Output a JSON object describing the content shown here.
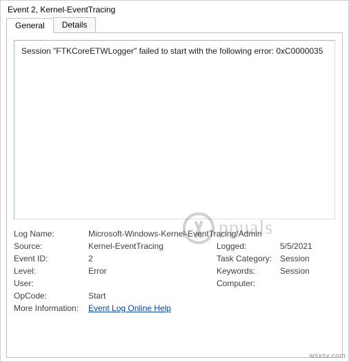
{
  "window": {
    "title": "Event 2, Kernel-EventTracing"
  },
  "tabs": {
    "general": "General",
    "details": "Details",
    "active": "general"
  },
  "description": "Session \"FTKCoreETWLogger\" failed to start with the following error: 0xC0000035",
  "meta": {
    "log_name_label": "Log Name:",
    "log_name": "Microsoft-Windows-Kernel-EventTracing/Admin",
    "source_label": "Source:",
    "source": "Kernel-EventTracing",
    "logged_label": "Logged:",
    "logged": "5/5/2021",
    "event_id_label": "Event ID:",
    "event_id": "2",
    "task_category_label": "Task Category:",
    "task_category": "Session",
    "level_label": "Level:",
    "level": "Error",
    "keywords_label": "Keywords:",
    "keywords": "Session",
    "user_label": "User:",
    "user": "",
    "computer_label": "Computer:",
    "computer": "",
    "opcode_label": "OpCode:",
    "opcode": "Start",
    "more_info_label": "More Information:",
    "more_info_link": "Event Log Online Help"
  },
  "watermark": {
    "text": "ppuals",
    "footer": "wsxsv.com"
  }
}
